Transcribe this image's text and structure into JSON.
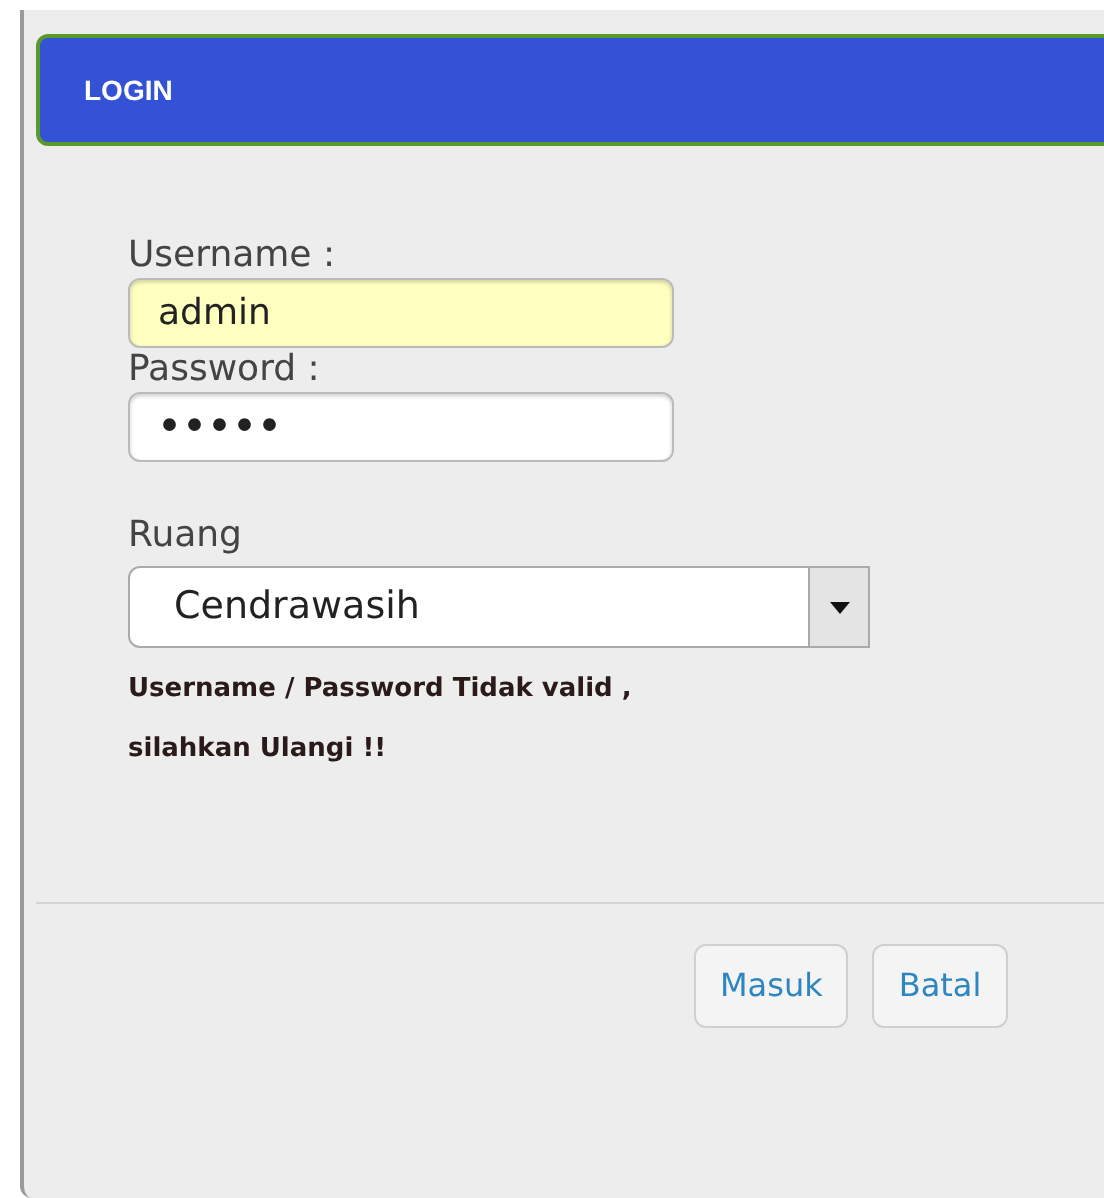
{
  "dialog": {
    "title": "LOGIN"
  },
  "fields": [
    {
      "kind": "text",
      "label": "Username :",
      "value": "admin",
      "highlighted": true
    },
    {
      "kind": "password",
      "label": "Password :",
      "value": "•••••",
      "highlighted": false
    }
  ],
  "room": {
    "label": "Ruang",
    "value": "Cendrawasih"
  },
  "error": [
    "Username / Password Tidak valid ,",
    "silahkan Ulangi !!"
  ],
  "buttons": [
    "Masuk",
    "Batal"
  ]
}
